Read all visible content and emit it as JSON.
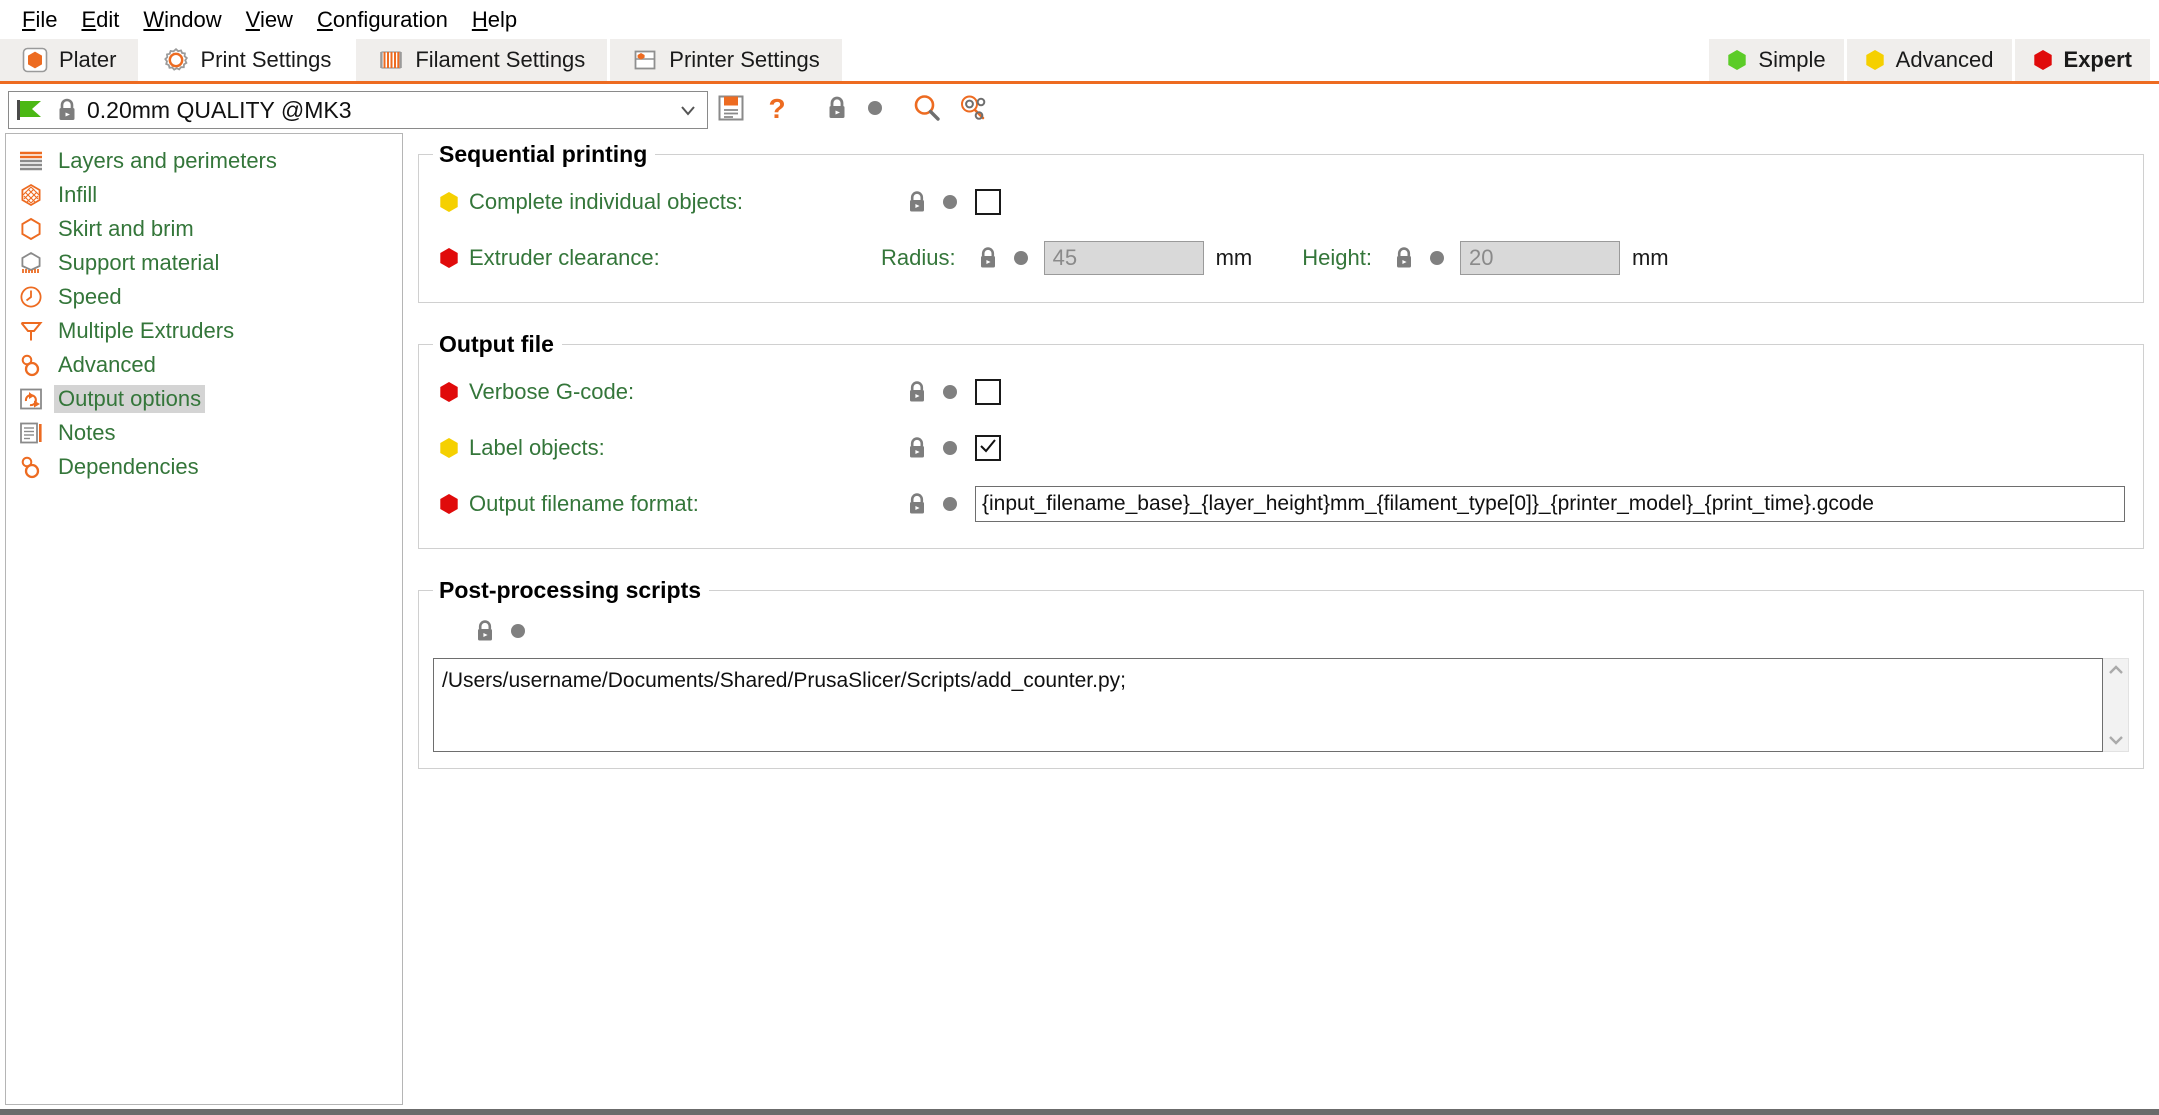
{
  "menubar": {
    "items": [
      {
        "mnemonic": "F",
        "rest": "ile"
      },
      {
        "mnemonic": "E",
        "rest": "dit"
      },
      {
        "mnemonic": "W",
        "rest": "indow"
      },
      {
        "mnemonic": "V",
        "rest": "iew"
      },
      {
        "mnemonic": "C",
        "rest": "onfiguration"
      },
      {
        "mnemonic": "H",
        "rest": "elp"
      }
    ]
  },
  "tabs": [
    {
      "label": "Plater",
      "icon": "plater-icon",
      "active": false
    },
    {
      "label": "Print Settings",
      "icon": "print-settings-gear-icon",
      "active": true
    },
    {
      "label": "Filament Settings",
      "icon": "filament-spool-icon",
      "active": false
    },
    {
      "label": "Printer Settings",
      "icon": "printer-icon",
      "active": false
    }
  ],
  "modes": [
    {
      "label": "Simple",
      "color": "#5ccc28",
      "selected": false
    },
    {
      "label": "Advanced",
      "color": "#f5d000",
      "selected": false
    },
    {
      "label": "Expert",
      "color": "#e00b0b",
      "selected": true
    }
  ],
  "preset": {
    "value": "0.20mm QUALITY @MK3",
    "flag_icon": "green-flag-icon",
    "lock_icon": "lock-closed-icon",
    "dropdown_icon": "chevron-down-icon",
    "save_icon": "save-floppy-icon",
    "help_icon": "question-mark-icon",
    "toolbar_lock_icon": "lock-closed-icon",
    "toolbar_dot_icon": "revert-dot-icon",
    "search_icon": "search-magnifier-icon",
    "compare_icon": "compare-presets-icon"
  },
  "sidebar": {
    "items": [
      {
        "label": "Layers and perimeters",
        "icon": "layers-icon",
        "selected": false
      },
      {
        "label": "Infill",
        "icon": "infill-icon",
        "selected": false
      },
      {
        "label": "Skirt and brim",
        "icon": "skirt-brim-icon",
        "selected": false
      },
      {
        "label": "Support material",
        "icon": "support-material-icon",
        "selected": false
      },
      {
        "label": "Speed",
        "icon": "speed-clock-icon",
        "selected": false
      },
      {
        "label": "Multiple Extruders",
        "icon": "multiple-extruders-icon",
        "selected": false
      },
      {
        "label": "Advanced",
        "icon": "advanced-cogs-icon",
        "selected": false
      },
      {
        "label": "Output options",
        "icon": "output-options-icon",
        "selected": true
      },
      {
        "label": "Notes",
        "icon": "notes-icon",
        "selected": false
      },
      {
        "label": "Dependencies",
        "icon": "dependencies-cogs-icon",
        "selected": false
      }
    ]
  },
  "content": {
    "sequential_printing": {
      "title": "Sequential printing",
      "complete_individual_objects": {
        "label": "Complete individual objects:",
        "mode_color": "#f5d000",
        "checked": false
      },
      "extruder_clearance": {
        "label": "Extruder clearance:",
        "mode_color": "#e00b0b",
        "radius_label": "Radius:",
        "radius_value": "45",
        "radius_unit": "mm",
        "height_label": "Height:",
        "height_value": "20",
        "height_unit": "mm"
      }
    },
    "output_file": {
      "title": "Output file",
      "verbose_gcode": {
        "label": "Verbose G-code:",
        "mode_color": "#e00b0b",
        "checked": false
      },
      "label_objects": {
        "label": "Label objects:",
        "mode_color": "#f5d000",
        "checked": true
      },
      "output_filename_format": {
        "label": "Output filename format:",
        "mode_color": "#e00b0b",
        "value": "{input_filename_base}_{layer_height}mm_{filament_type[0]}_{printer_model}_{print_time}.gcode"
      }
    },
    "post_processing": {
      "title": "Post-processing scripts",
      "value": "/Users/username/Documents/Shared/PrusaSlicer/Scripts/add_counter.py;",
      "scroll_up_icon": "chevron-up-icon",
      "scroll_down_icon": "chevron-down-icon"
    }
  }
}
